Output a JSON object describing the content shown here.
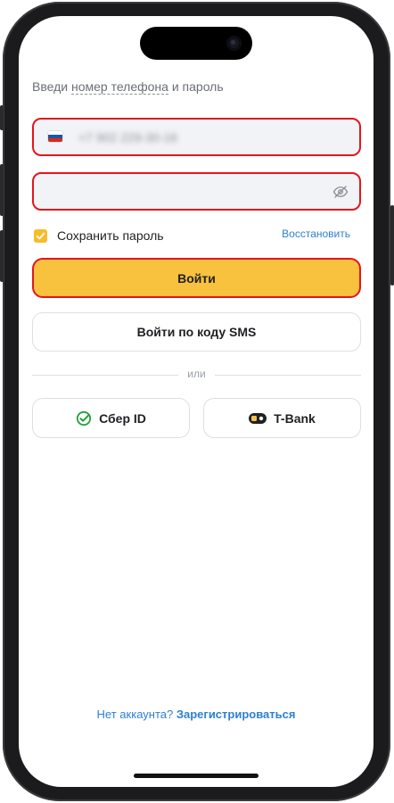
{
  "prompt": {
    "before": "Введи",
    "dashed": "номер телефона",
    "after": "и пароль"
  },
  "phone_field": {
    "flag_colors": [
      "#ffffff",
      "#1c57a7",
      "#d52b1e"
    ],
    "value": "+7 902 229-30-16",
    "value_blurred": true
  },
  "password_field": {
    "value": "",
    "toggle_icon": "eye-off-icon"
  },
  "remember": {
    "checked": true,
    "label": "Сохранить пароль"
  },
  "restore_link": "Восстановить",
  "login_button": "Войти",
  "sms_button": "Войти по коду SMS",
  "divider_text": "или",
  "sber_button": {
    "label": "Сбер ID",
    "icon": "sber-check-icon"
  },
  "tbank_button": {
    "label": "T-Bank",
    "icon": "tbank-icon"
  },
  "register": {
    "question": "Нет аккаунта?",
    "link": "Зарегистрироваться"
  },
  "colors": {
    "accent_yellow": "#f8c13e",
    "error_red": "#e4151e",
    "link_blue": "#2d7fd6",
    "sber_green": "#21a038"
  }
}
